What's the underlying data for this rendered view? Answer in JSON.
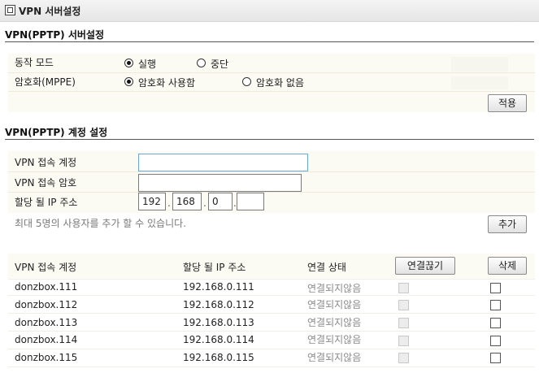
{
  "window": {
    "title": "VPN 서버설정"
  },
  "server_section": {
    "title": "VPN(PPTP) 서버설정",
    "mode_label": "동작 모드",
    "mode_options": [
      "실행",
      "중단"
    ],
    "mode_selected": "실행",
    "encryption_label": "암호화(MPPE)",
    "encryption_options": [
      "암호화 사용함",
      "암호화 없음"
    ],
    "encryption_selected": "암호화 사용함",
    "apply_label": "적용"
  },
  "account_section": {
    "title": "VPN(PPTP) 계정 설정",
    "account_label": "VPN 접속 계정",
    "account_value": "",
    "password_label": "VPN 접속 암호",
    "password_value": "",
    "ip_label": "할당 될 IP 주소",
    "ip_octets": [
      "192",
      "168",
      "0",
      ""
    ],
    "hint": "최대 5명의 사용자를 추가 할 수 있습니다.",
    "add_label": "추가"
  },
  "table": {
    "headers": {
      "account": "VPN 접속 계정",
      "ip": "할당 될 IP 주소",
      "status": "연결 상태",
      "disconnect": "연결끊기",
      "delete": "삭제"
    },
    "rows": [
      {
        "account": "donzbox.111",
        "ip": "192.168.0.111",
        "status": "연결되지않음"
      },
      {
        "account": "donzbox.112",
        "ip": "192.168.0.112",
        "status": "연결되지않음"
      },
      {
        "account": "donzbox.113",
        "ip": "192.168.0.113",
        "status": "연결되지않음"
      },
      {
        "account": "donzbox.114",
        "ip": "192.168.0.114",
        "status": "연결되지않음"
      },
      {
        "account": "donzbox.115",
        "ip": "192.168.0.115",
        "status": "연결되지않음"
      }
    ]
  }
}
